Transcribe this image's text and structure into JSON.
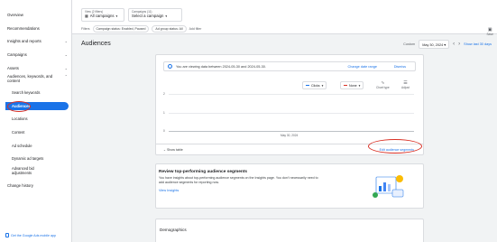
{
  "sidebar": {
    "items": [
      {
        "label": "Overview",
        "chevron": false
      },
      {
        "label": "Recommendations",
        "chevron": false
      },
      {
        "label": "Insights and reports",
        "chevron": true
      },
      {
        "label": "Campaigns",
        "chevron": true
      },
      {
        "label": "Assets",
        "chevron": true
      },
      {
        "label": "Audiences, keywords, and content",
        "chevron": true
      }
    ],
    "sub_items": [
      {
        "label": "Search keywords"
      },
      {
        "label": "Audiences",
        "active": true
      },
      {
        "label": "Locations"
      },
      {
        "label": "Content"
      },
      {
        "label": "Ad schedule"
      },
      {
        "label": "Dynamic ad targets"
      },
      {
        "label": "Advanced bid adjustments"
      }
    ],
    "change_history": "Change history",
    "mobile_app": "Get the Google Ads mobile app"
  },
  "header": {
    "view_label": "View (2 filters)",
    "view_value": "All campaigns",
    "campaigns_label": "Campaigns (11)",
    "campaigns_value": "Select a campaign",
    "filters_label": "Filters",
    "filter_chips": [
      "Campaign status: Enabled, Paused",
      "Ad group status: All"
    ],
    "add_filter": "Add filter",
    "save_label": "Save"
  },
  "page": {
    "title": "Audiences",
    "date_label": "Custom",
    "date_value": "May 30, 2024",
    "show_last": "Show last 30 days"
  },
  "chart_card": {
    "banner_text": "You are viewing data between 2024-05-30 and 2024-05-30.",
    "change_date_range": "Change date range",
    "dismiss": "Dismiss",
    "metric1": "Clicks",
    "metric1_color": "#1a73e8",
    "metric2": "None",
    "metric2_color": "#d93025",
    "chart_type": "Chart type",
    "adjust": "Adjust",
    "y_ticks": [
      "2",
      "1",
      "0"
    ],
    "x_tick": "May 30, 2024",
    "show_table": "Show table",
    "edit_segments": "Edit audience segments"
  },
  "review_card": {
    "title": "Review top-performing audience segments",
    "description": "You have insights about top-performing audience segments on the Insights page. You don't necessarily need to add audience segments for reporting now.",
    "link": "View Insights"
  },
  "demographics": {
    "title": "Demographics"
  },
  "colors": {
    "accent": "#1a73e8",
    "annotation_red": "#d93025"
  }
}
